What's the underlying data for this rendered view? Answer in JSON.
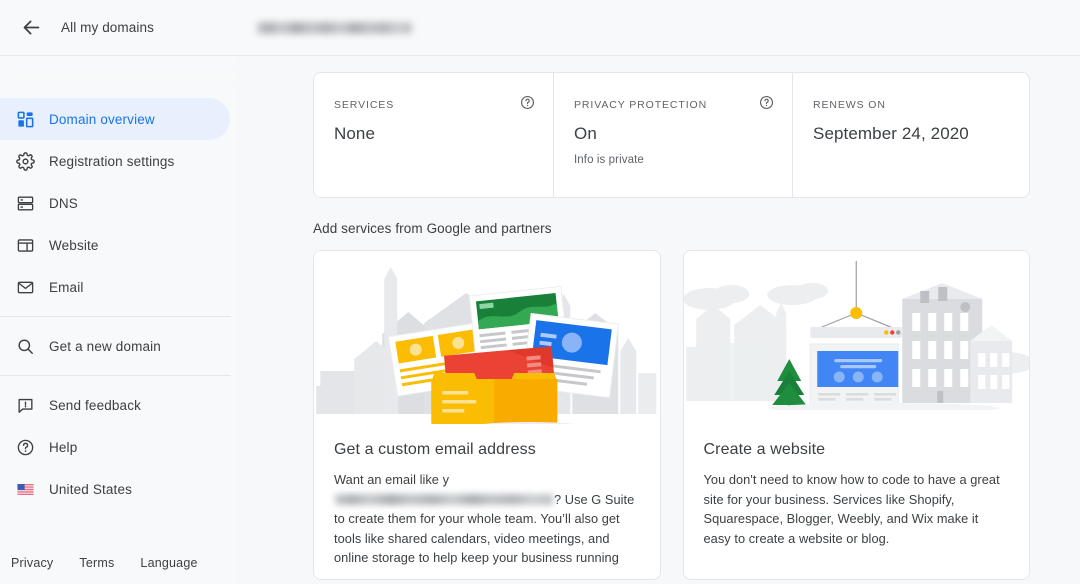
{
  "topbar": {
    "back_icon": "arrow-back-icon",
    "all_domains_label": "All my domains",
    "domain_name": "[redacted domain]"
  },
  "sidebar": {
    "domain_name": "[redacted domain]",
    "items": [
      {
        "label": "Domain overview",
        "icon": "dashboard-icon",
        "active": true
      },
      {
        "label": "Registration settings",
        "icon": "gear-icon",
        "active": false
      },
      {
        "label": "DNS",
        "icon": "dns-icon",
        "active": false
      },
      {
        "label": "Website",
        "icon": "website-icon",
        "active": false
      },
      {
        "label": "Email",
        "icon": "envelope-icon",
        "active": false
      },
      {
        "label": "Get a new domain",
        "icon": "search-icon",
        "active": false
      },
      {
        "label": "Send feedback",
        "icon": "feedback-icon",
        "active": false
      },
      {
        "label": "Help",
        "icon": "help-circle-icon",
        "active": false
      },
      {
        "label": "United States",
        "icon": "us-flag-icon",
        "active": false
      }
    ],
    "footer": [
      {
        "label": "Privacy"
      },
      {
        "label": "Terms"
      },
      {
        "label": "Language"
      }
    ]
  },
  "main": {
    "info_card": {
      "columns": [
        {
          "label": "SERVICES",
          "value": "None",
          "sub": "",
          "help": true
        },
        {
          "label": "PRIVACY PROTECTION",
          "value": "On",
          "sub": "Info is private",
          "help": true
        },
        {
          "label": "RENEWS ON",
          "value": "September 24, 2020",
          "sub": "",
          "help": false
        }
      ]
    },
    "section_title": "Add services from Google and partners",
    "promos": [
      {
        "illustration": "mail-box-illustration",
        "title": "Get a custom email address",
        "body_before": "Want an email like y",
        "body_redacted": "[redacted email address]",
        "body_after": "? Use G Suite to create them for your whole team. You’ll also get tools like shared calendars, video meetings, and online storage to help keep your business running"
      },
      {
        "illustration": "website-builder-illustration",
        "title": "Create a website",
        "body_before": "",
        "body_redacted": "",
        "body_after": "You don't need to know how to code to have a great site for your business. Services like Shopify, Squarespace, Blogger, Weebly, and Wix make it easy to create a website or blog."
      }
    ]
  },
  "colors": {
    "accent": "#1a73e8",
    "accent_bg": "#e8f0fe",
    "page_bg": "#f6f8fa",
    "panel_bg": "#f8f9fa",
    "card_bg": "#ffffff",
    "border": "#e4e6e9",
    "text": "#3c4043",
    "text_muted": "#5f6368"
  }
}
